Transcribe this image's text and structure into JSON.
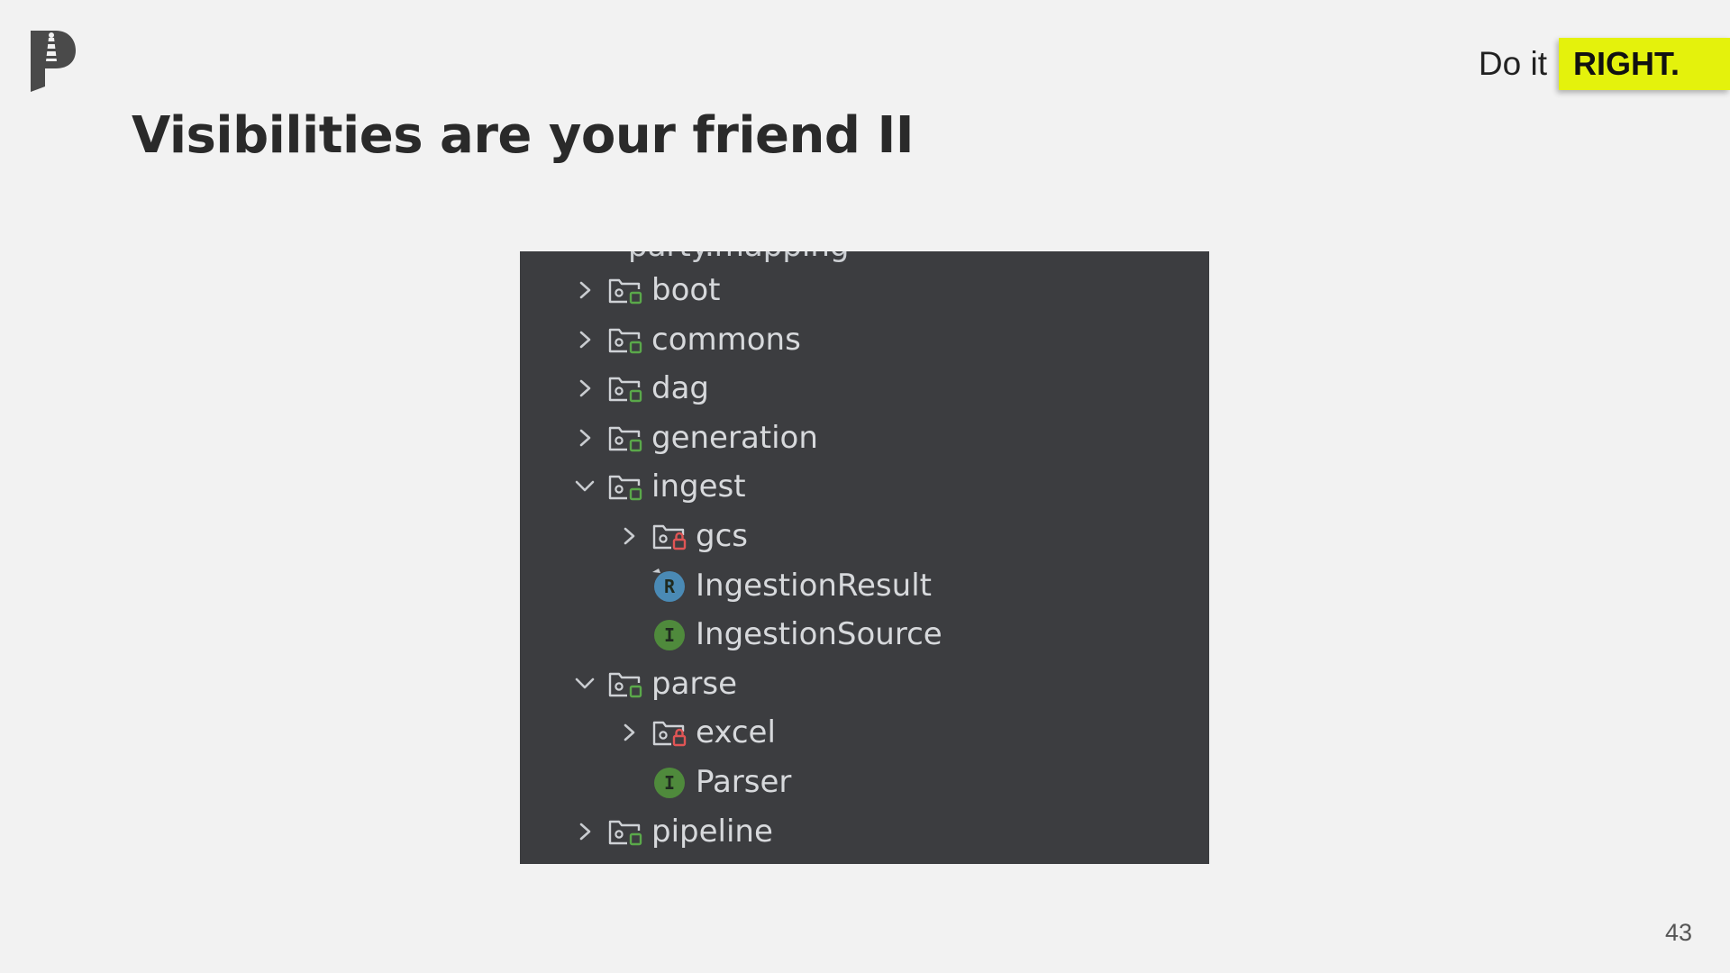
{
  "header": {
    "tagline_prefix": "Do it",
    "tagline_highlight": "RIGHT.",
    "highlight_color": "#e4f20c"
  },
  "slide": {
    "title": "Visibilities are your friend II",
    "page_number": "43"
  },
  "project_tree": {
    "partial_top_label": "party.mapping",
    "items": [
      {
        "label": "boot",
        "kind": "package",
        "visibility": "open",
        "expanded": false,
        "depth": 0
      },
      {
        "label": "commons",
        "kind": "package",
        "visibility": "open",
        "expanded": false,
        "depth": 0
      },
      {
        "label": "dag",
        "kind": "package",
        "visibility": "open",
        "expanded": false,
        "depth": 0
      },
      {
        "label": "generation",
        "kind": "package",
        "visibility": "open",
        "expanded": false,
        "depth": 0
      },
      {
        "label": "ingest",
        "kind": "package",
        "visibility": "open",
        "expanded": true,
        "depth": 0
      },
      {
        "label": "gcs",
        "kind": "package",
        "visibility": "locked",
        "expanded": false,
        "depth": 1
      },
      {
        "label": "IngestionResult",
        "kind": "record",
        "icon_letter": "R",
        "depth": 1
      },
      {
        "label": "IngestionSource",
        "kind": "interface",
        "icon_letter": "I",
        "depth": 1
      },
      {
        "label": "parse",
        "kind": "package",
        "visibility": "open",
        "expanded": true,
        "depth": 0
      },
      {
        "label": "excel",
        "kind": "package",
        "visibility": "locked",
        "expanded": false,
        "depth": 1
      },
      {
        "label": "Parser",
        "kind": "interface",
        "icon_letter": "I",
        "depth": 1
      },
      {
        "label": "pipeline",
        "kind": "package",
        "visibility": "open",
        "expanded": false,
        "depth": 0
      }
    ]
  },
  "colors": {
    "ide_background": "#3c3d40",
    "open_badge": "#5aa84a",
    "locked_badge": "#e05555",
    "record_icon": "#4a8ab5",
    "interface_icon": "#4f8a3c"
  }
}
